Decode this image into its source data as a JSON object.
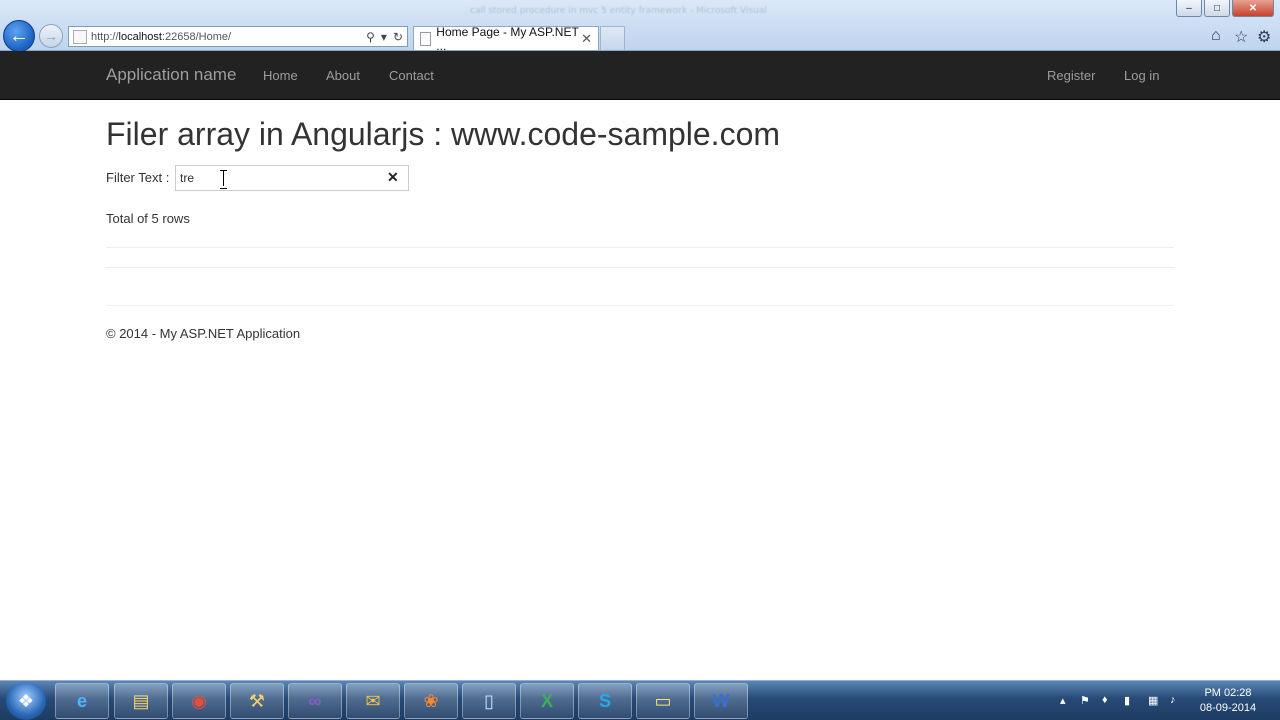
{
  "browser": {
    "window_title": "call stored procedure in mvc 5 entity framework - Microsoft Visual",
    "address_url_prefix": "http://",
    "address_host": "localhost",
    "address_url_rest": ":22658/Home/",
    "tab_title": "Home Page - My ASP.NET ...",
    "controls": {
      "minimize": "–",
      "maximize": "□",
      "close": "✕"
    },
    "icons": {
      "back": "back-arrow-icon",
      "forward": "forward-arrow-icon",
      "home": "home-icon",
      "favorites": "star-icon",
      "tools": "gear-icon"
    }
  },
  "navbar": {
    "brand": "Application name",
    "links": [
      "Home",
      "About",
      "Contact"
    ],
    "right_links": [
      "Register",
      "Log in"
    ]
  },
  "main": {
    "title": "Filer array in Angularjs : www.code-sample.com",
    "filter_label": "Filter Text :",
    "filter_value": "tre",
    "clear_glyph": "✕",
    "total_text": "Total of 5 rows"
  },
  "footer": {
    "text": "© 2014 - My ASP.NET Application"
  },
  "taskbar": {
    "apps": [
      "ie-icon",
      "explorer-icon",
      "chrome-icon",
      "tools-icon",
      "visual-studio-icon",
      "outlook-icon",
      "butterfly-icon",
      "notes-icon",
      "excel-icon",
      "skype-icon",
      "folder-icon",
      "word-icon"
    ],
    "clock_time": "PM 02:28",
    "clock_date": "08-09-2014"
  },
  "colors": {
    "navbar_bg": "#222222",
    "navbar_text": "#9d9d9d",
    "body_text": "#333333"
  }
}
